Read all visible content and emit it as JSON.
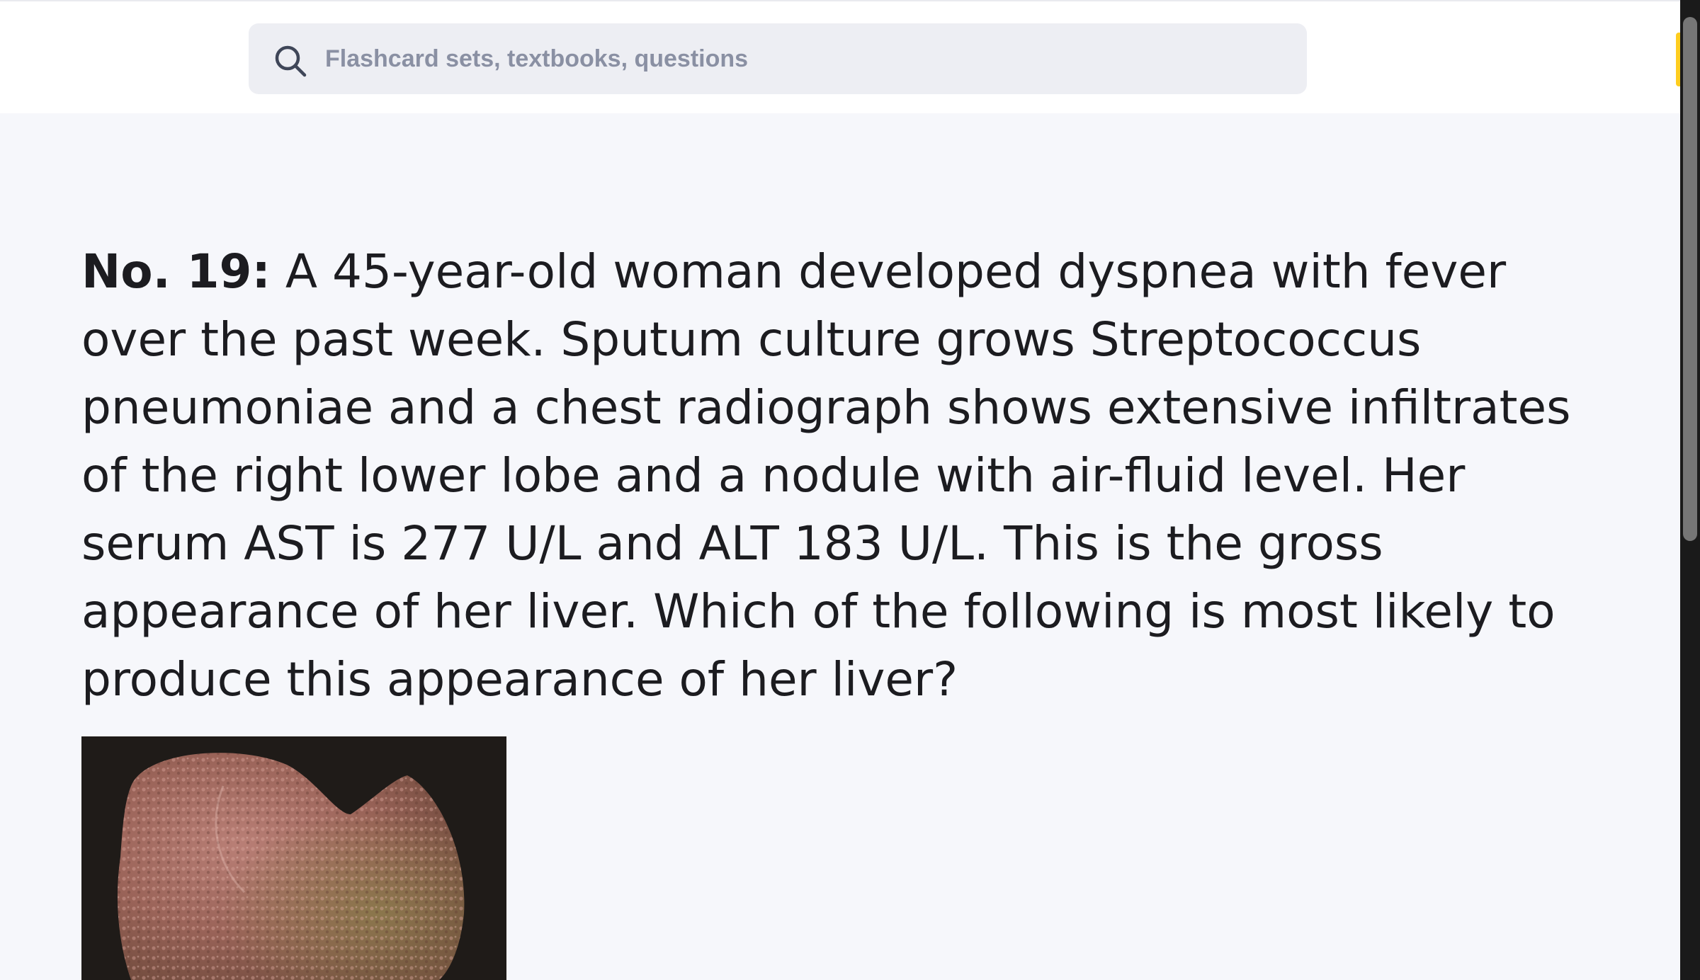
{
  "search": {
    "placeholder": "Flashcard sets, textbooks, questions",
    "icon": "search-icon"
  },
  "question": {
    "number_label": "No. 19:",
    "text": " A 45-year-old woman developed dyspnea with fever over the past week. Sputum culture grows Streptococcus pneumoniae and a chest radiograph shows extensive infiltrates of the right lower lobe and a nodule with air-fluid level. Her serum AST is 277 U/L and ALT 183 U/L. This is the gross appearance of her liver. Which of the following is most likely to produce this appearance of her liver?"
  },
  "colors": {
    "accent": "#ffcd1f",
    "page_background": "#f6f7fb",
    "search_background": "#edeef3",
    "text": "#1c1c20"
  }
}
